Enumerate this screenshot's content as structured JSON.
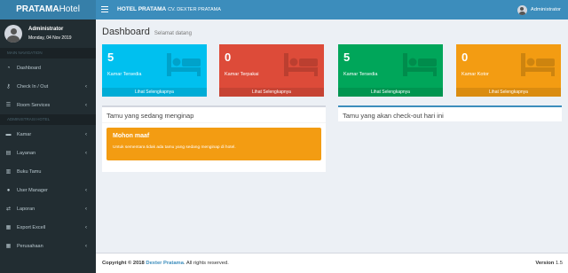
{
  "logo": {
    "bold": "PRATAMA",
    "light": "Hotel"
  },
  "topbar": {
    "hotel": "HOTEL PRATAMA",
    "owner": "CV. DEXTER PRATAMA",
    "user": "Administrator"
  },
  "sidebar": {
    "user_name": "Administrator",
    "user_date": "Monday, 04 Nov 2019",
    "header_main": "MAIN NAVIGATION",
    "header_admin": "ADMINISTRASI HOTEL",
    "main_items": [
      {
        "label": "Dashboard",
        "icon": "dashboard-icon"
      },
      {
        "label": "Check In / Out",
        "icon": "key-icon"
      },
      {
        "label": "Room Services",
        "icon": "list-icon"
      }
    ],
    "admin_items": [
      {
        "label": "Kamar",
        "icon": "bed-icon"
      },
      {
        "label": "Layanan",
        "icon": "clipboard-icon"
      },
      {
        "label": "Buku Tamu",
        "icon": "book-icon"
      },
      {
        "label": "User Manager",
        "icon": "user-icon"
      },
      {
        "label": "Laporan",
        "icon": "exchange-icon"
      },
      {
        "label": "Export Excell",
        "icon": "file-excel-icon"
      },
      {
        "label": "Perusahaan",
        "icon": "building-icon"
      }
    ]
  },
  "page": {
    "title": "Dashboard",
    "subtitle": "Selamat datang"
  },
  "stats": [
    {
      "value": "5",
      "label": "Kamar Tersedia",
      "link": "Lihat Selengkapnya",
      "color": "#00c0ef"
    },
    {
      "value": "0",
      "label": "Kamar Terpakai",
      "link": "Lihat Selengkapnya",
      "color": "#dd4b39"
    },
    {
      "value": "5",
      "label": "Kamar Tersedia",
      "link": "Lihat Selengkapnya",
      "color": "#00a65a"
    },
    {
      "value": "0",
      "label": "Kamar Kotor",
      "link": "Lihat Selengkapnya",
      "color": "#f39c12"
    }
  ],
  "panels": {
    "staying_title": "Tamu yang sedang menginap",
    "checkout_title": "Tamu yang akan check-out hari ini",
    "callout_title": "Mohon maaf",
    "callout_message": "Untuk sementara tidak ada tamu yang sedang menginap di hotel."
  },
  "footer": {
    "copyright": "Copyright © 2018",
    "company": "Dexter Pratama",
    "rights": ". All rights reserved.",
    "version_label": "Version",
    "version": "1.5"
  }
}
